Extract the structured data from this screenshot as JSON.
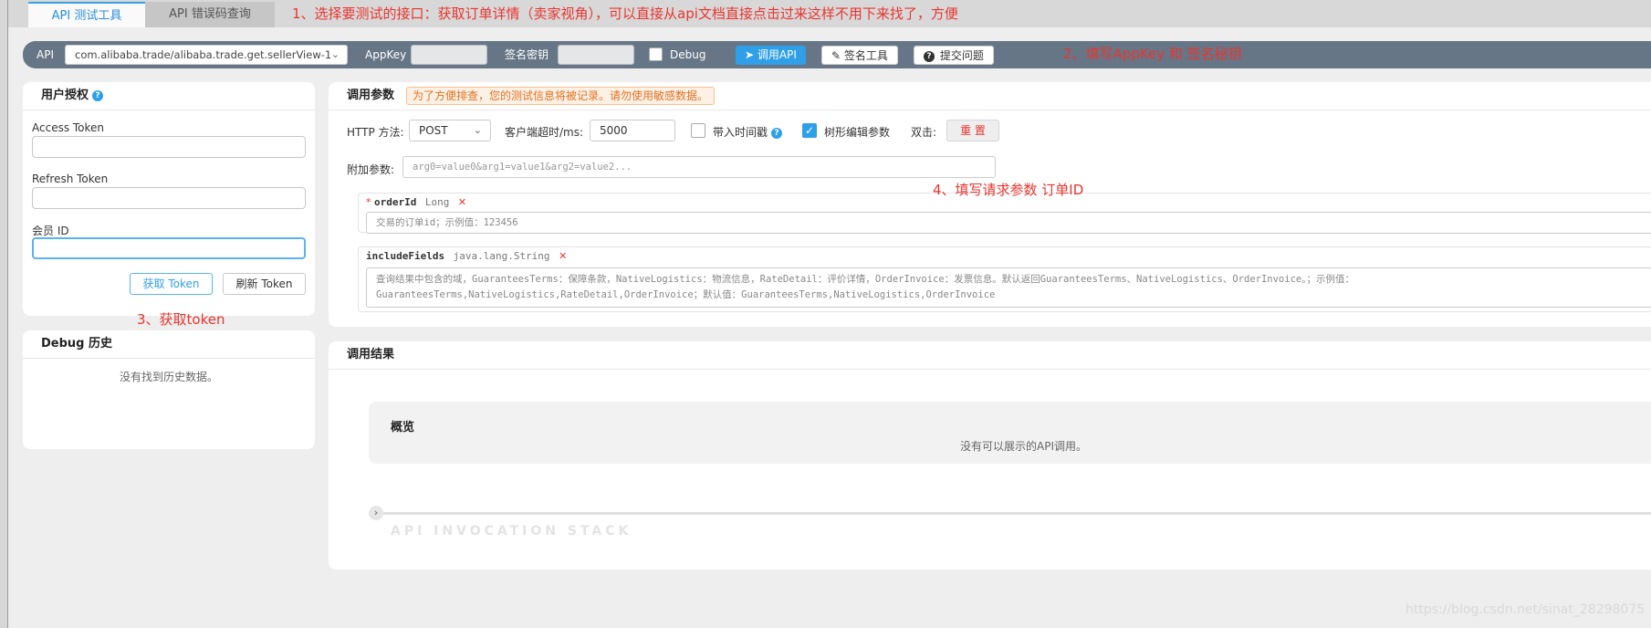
{
  "tabs": [
    {
      "label": "API 测试工具",
      "active": true
    },
    {
      "label": "API 错误码查询",
      "active": false
    }
  ],
  "annotations": {
    "note1": "1、选择要测试的接口：获取订单详情（卖家视角），可以直接从api文档直接点击过来这样不用下来找了，方便",
    "note2": "2、填写AppKey 和 签名秘钥",
    "note3": "3、获取token",
    "note4": "4、填写请求参数 订单ID"
  },
  "toolbar": {
    "api_label": "API",
    "api_value": "com.alibaba.trade/alibaba.trade.get.sellerView-1",
    "appkey_label": "AppKey",
    "secret_label": "签名密钥",
    "debug_label": "Debug",
    "invoke_button": "调用API",
    "sign_tool_button": "签名工具",
    "submit_issue_button": "提交问题"
  },
  "auth": {
    "title": "用户授权",
    "access_token_label": "Access Token",
    "refresh_token_label": "Refresh Token",
    "member_id_label": "会员 ID",
    "get_token_button": "获取 Token",
    "refresh_token_button": "刷新 Token"
  },
  "history": {
    "title": "Debug 历史",
    "empty_text": "没有找到历史数据。"
  },
  "params": {
    "title": "调用参数",
    "warning": "为了方便排查，您的测试信息将被记录。请勿使用敏感数据。",
    "http_method_label": "HTTP 方法:",
    "http_method_value": "POST",
    "timeout_label": "客户端超时/ms:",
    "timeout_value": "5000",
    "timestamp_label": "带入时间戳",
    "tree_edit_label": "树形编辑参数",
    "double_click_label": "双击:",
    "reset_button": "重 置",
    "extra_label": "附加参数:",
    "extra_placeholder": "arg0=value0&arg1=value1&arg2=value2...",
    "fields": [
      {
        "required_mark": "*",
        "name": "orderId",
        "type": "Long",
        "remove": "✕",
        "placeholder": "交易的订单id；示例值：123456"
      },
      {
        "required_mark": "",
        "name": "includeFields",
        "type": "java.lang.String",
        "remove": "✕",
        "placeholder_line1": "查询结果中包含的域，GuaranteesTerms：保障条款，NativeLogistics：物流信息，RateDetail：评价详情，OrderInvoice：发票信息。默认返回GuaranteesTerms、NativeLogistics、OrderInvoice。；示例值：",
        "placeholder_line2": "GuaranteesTerms,NativeLogistics,RateDetail,OrderInvoice；默认值：GuaranteesTerms,NativeLogistics,OrderInvoice"
      }
    ]
  },
  "result": {
    "title": "调用结果",
    "overview_title": "概览",
    "overview_empty": "没有可以展示的API调用。",
    "stack_label": "API INVOCATION STACK"
  },
  "watermark": "https://blog.csdn.net/sinat_28298075",
  "colors": {
    "accent": "#2f9fe8",
    "annotation_red": "#e8352f",
    "toolbar_bg": "#677687",
    "warning_orange": "#e07222"
  }
}
